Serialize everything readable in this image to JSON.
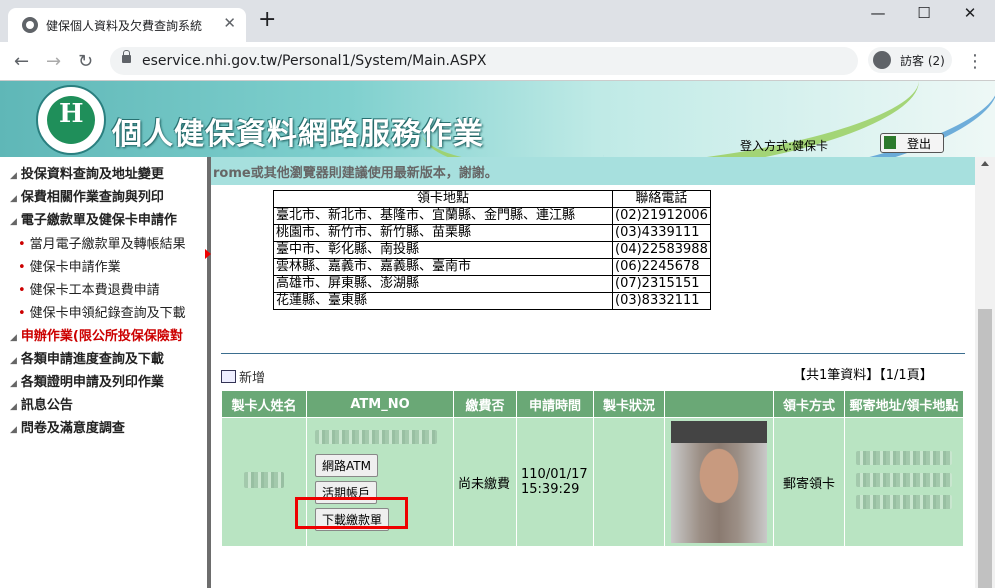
{
  "browser": {
    "tab_title": "健保個人資料及欠費查詢系統",
    "tab_close": "✕",
    "new_tab": "+",
    "win_min": "—",
    "win_max": "☐",
    "win_close": "✕",
    "back": "←",
    "forward": "→",
    "reload": "↻",
    "url": "eservice.nhi.gov.tw/Personal1/System/Main.ASPX",
    "profile_label": "訪客 (2)",
    "menu": "⋮"
  },
  "header": {
    "title": "個人健保資料網路服務作業",
    "login_method": "登入方式:健保卡",
    "logout_label": "登出"
  },
  "sidebar": {
    "items": [
      {
        "label": "投保資料查詢及地址變更"
      },
      {
        "label": "保費相關作業查詢與列印"
      },
      {
        "label": "電子繳款單及健保卡申請作"
      },
      {
        "label": "當月電子繳款單及轉帳結果"
      },
      {
        "label": "健保卡申請作業"
      },
      {
        "label": "健保卡工本費退費申請"
      },
      {
        "label": "健保卡申領紀錄查詢及下載"
      },
      {
        "label": "申辦作業(限公所投保保險對"
      },
      {
        "label": "各類申請進度查詢及下載"
      },
      {
        "label": "各類證明申請及列印作業"
      },
      {
        "label": "訊息公告"
      },
      {
        "label": "問卷及滿意度調查"
      }
    ]
  },
  "main": {
    "notice": "rome或其他瀏覽器則建議使用最新版本，謝謝。",
    "location_table": {
      "headers": [
        "領卡地點",
        "聯絡電話"
      ],
      "rows": [
        [
          "臺北市、新北市、基隆市、宜蘭縣、金門縣、連江縣",
          "(02)21912006"
        ],
        [
          "桃園市、新竹市、新竹縣、苗栗縣",
          "(03)4339111"
        ],
        [
          "臺中市、彰化縣、南投縣",
          "(04)22583988"
        ],
        [
          "雲林縣、嘉義市、嘉義縣、臺南市",
          "(06)2245678"
        ],
        [
          "高雄市、屏東縣、澎湖縣",
          "(07)2315151"
        ],
        [
          "花蓮縣、臺東縣",
          "(03)8332111"
        ]
      ]
    },
    "add_label": "新增",
    "page_info": "【共1筆資料】【1/1頁】",
    "grid": {
      "headers": [
        "製卡人姓名",
        "ATM_NO",
        "繳費否",
        "申請時間",
        "製卡狀況",
        "",
        "領卡方式",
        "郵寄地址/領卡地點"
      ],
      "row": {
        "btn_atm": "網路ATM",
        "btn_savings": "活期帳戶",
        "btn_download": "下載繳款單",
        "paid": "尚未繳費",
        "apply_time": "110/01/17 15:39:29",
        "pickup": "郵寄領卡"
      }
    }
  }
}
